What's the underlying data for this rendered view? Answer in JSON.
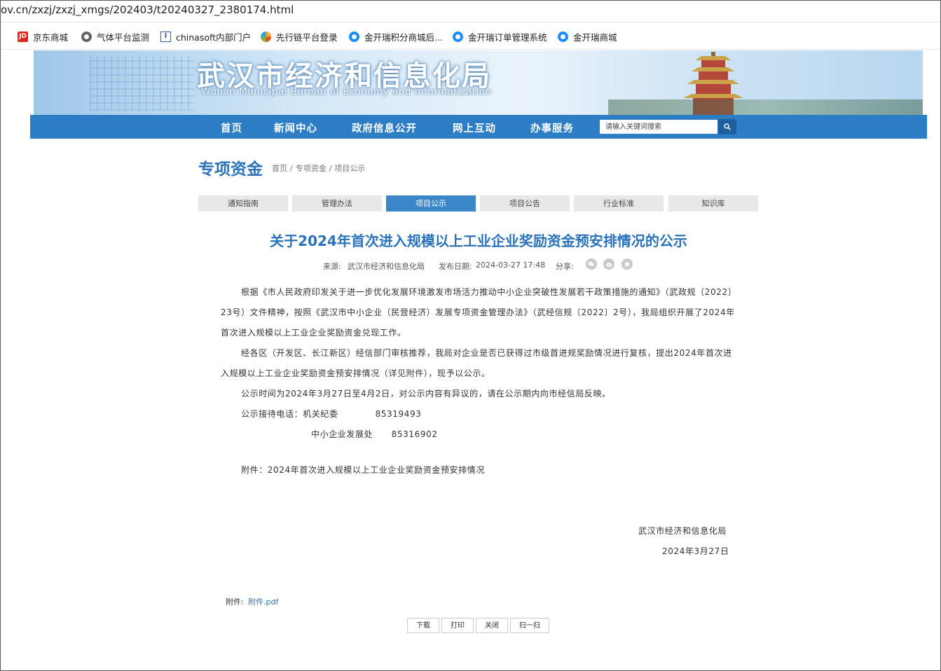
{
  "browser": {
    "url": "ov.cn/zxzj/zxzj_xmgs/202403/t20240327_2380174.html",
    "bookmarks": [
      {
        "label": "京东商城",
        "icon": "jd-icon"
      },
      {
        "label": "气体平台监测",
        "icon": "globe-icon"
      },
      {
        "label": "chinasoft内部门户",
        "icon": "chinasoft-icon"
      },
      {
        "label": "先行链平台登录",
        "icon": "chain-icon"
      },
      {
        "label": "金开瑞积分商城后...",
        "icon": "jinkairui-icon"
      },
      {
        "label": "金开瑞订单管理系统",
        "icon": "jinkairui-icon"
      },
      {
        "label": "金开瑞商城",
        "icon": "jinkairui-icon"
      }
    ],
    "jd_icon_text": "JD",
    "i_icon_text": "I"
  },
  "banner": {
    "title": "武汉市经济和信息化局",
    "subtitle": "Wuhan Municipal Bureau of Economy and Informatization"
  },
  "nav": {
    "items": [
      "首页",
      "新闻中心",
      "政府信息公开",
      "网上互动",
      "办事服务"
    ],
    "search_placeholder": "请输入关键词搜索"
  },
  "section": {
    "title": "专项资金",
    "breadcrumb": [
      "首页",
      "专项资金",
      "项目公示"
    ]
  },
  "tabs": [
    {
      "label": "通知指南",
      "active": false
    },
    {
      "label": "管理办法",
      "active": false
    },
    {
      "label": "项目公示",
      "active": true
    },
    {
      "label": "项目公告",
      "active": false
    },
    {
      "label": "行业标准",
      "active": false
    },
    {
      "label": "知识库",
      "active": false
    }
  ],
  "article": {
    "title": "关于2024年首次进入规模以上工业企业奖励资金预安排情况的公示",
    "source_label": "来源:",
    "source": "武汉市经济和信息化局",
    "date_label": "发布日期:",
    "date": "2024-03-27 17:48",
    "share_label": "分享:",
    "paragraphs": [
      "根据《市人民政府印发关于进一步优化发展环境激发市场活力推动中小企业突破性发展若干政策措施的通知》（武政规〔2022〕23号）文件精神，按照《武汉市中小企业（民营经济）发展专项资金管理办法》（武经信规〔2022〕2号），我局组织开展了2024年首次进入规模以上工业企业奖励资金兑现工作。",
      "经各区（开发区、长江新区）经信部门审核推荐，我局对企业是否已获得过市级首进规奖励情况进行复核，提出2024年首次进入规模以上工业企业奖励资金预安排情况（详见附件），现予以公示。",
      "公示时间为2024年3月27日至4月2日，对公示内容有异议的，请在公示期内向市经信局反映。"
    ],
    "contact_line1": "公示接待电话：机关纪委            85319493",
    "contact_line2": "中小企业发展处      85316902",
    "attachment_text": "附件：2024年首次进入规模以上工业企业奖励资金预安排情况",
    "signature": "武汉市经济和信息化局",
    "sign_date": "2024年3月27日"
  },
  "attachment": {
    "label": "附件:",
    "link": "附件.pdf"
  },
  "actions": [
    "下载",
    "打印",
    "关闭",
    "扫一扫"
  ]
}
